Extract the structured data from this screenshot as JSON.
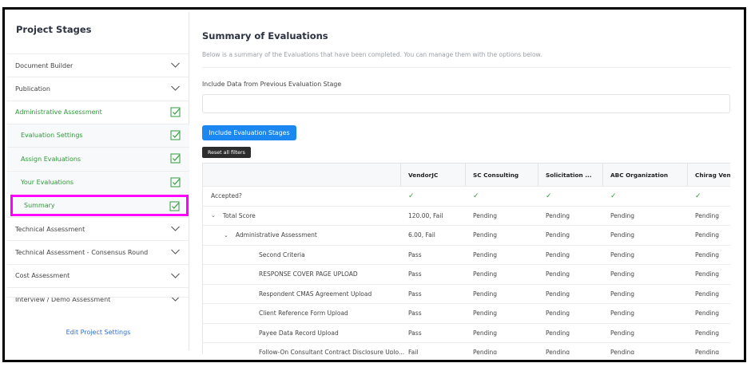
{
  "sidebar": {
    "title": "Project Stages",
    "items": [
      {
        "label": "Document Builder",
        "state": "collapsed",
        "sub": false,
        "green": false
      },
      {
        "label": "Publication",
        "state": "collapsed",
        "sub": false,
        "green": false
      },
      {
        "label": "Administrative Assessment",
        "state": "checked",
        "sub": false,
        "green": true
      },
      {
        "label": "Evaluation Settings",
        "state": "checked",
        "sub": true,
        "green": true
      },
      {
        "label": "Assign Evaluations",
        "state": "checked",
        "sub": true,
        "green": true
      },
      {
        "label": "Your Evaluations",
        "state": "checked",
        "sub": true,
        "green": true
      },
      {
        "label": "Summary",
        "state": "checked",
        "sub": true,
        "green": true,
        "selected": true
      },
      {
        "label": "Technical Assessment",
        "state": "collapsed",
        "sub": false,
        "green": false
      },
      {
        "label": "Technical Assessment - Consensus Round",
        "state": "collapsed",
        "sub": false,
        "green": false
      },
      {
        "label": "Cost Assessment",
        "state": "collapsed",
        "sub": false,
        "green": false
      },
      {
        "label": "Interview / Demo Assessment",
        "state": "collapsed",
        "sub": false,
        "green": false
      }
    ],
    "edit_link": "Edit Project Settings"
  },
  "main": {
    "title": "Summary of Evaluations",
    "subtitle": "Below is a summary of the Evaluations that have been completed. You can manage them with the options below.",
    "field_label": "Include Data from Previous Evaluation Stage",
    "field_value": "",
    "include_button": "Include Evaluation Stages",
    "reset_button": "Reset all filters"
  },
  "table": {
    "columns": [
      "",
      "VendorJC",
      "SC Consulting",
      "Solicitation ...",
      "ABC Organization",
      "Chirag Vendo"
    ],
    "rows": [
      {
        "indent": 0,
        "caret": "",
        "label": "Accepted?",
        "cells": [
          "✓",
          "✓",
          "✓",
          "✓",
          "✓"
        ],
        "check": true
      },
      {
        "indent": 0,
        "caret": "⌄",
        "label": "Total Score",
        "cells": [
          "120.00, Fail",
          "Pending",
          "Pending",
          "Pending",
          "Pending"
        ]
      },
      {
        "indent": 1,
        "caret": "⌄",
        "label": "Administrative Assessment",
        "cells": [
          "6.00, Fail",
          "Pending",
          "Pending",
          "Pending",
          "Pending"
        ]
      },
      {
        "indent": 2,
        "caret": "",
        "label": "Second Criteria",
        "cells": [
          "Pass",
          "Pending",
          "Pending",
          "Pending",
          "Pending"
        ]
      },
      {
        "indent": 2,
        "caret": "",
        "label": "RESPONSE COVER PAGE UPLOAD",
        "cells": [
          "Pass",
          "Pending",
          "Pending",
          "Pending",
          "Pending"
        ]
      },
      {
        "indent": 2,
        "caret": "",
        "label": "Respondent CMAS Agreement Upload",
        "cells": [
          "Pass",
          "Pending",
          "Pending",
          "Pending",
          "Pending"
        ]
      },
      {
        "indent": 2,
        "caret": "",
        "label": "Client Reference Form Upload",
        "cells": [
          "Pass",
          "Pending",
          "Pending",
          "Pending",
          "Pending"
        ]
      },
      {
        "indent": 2,
        "caret": "",
        "label": "Payee Data Record Upload",
        "cells": [
          "Pass",
          "Pending",
          "Pending",
          "Pending",
          "Pending"
        ]
      },
      {
        "indent": 2,
        "caret": "",
        "label": "Follow-On Consultant Contract Disclosure Uplo...",
        "cells": [
          "Fail",
          "Pending",
          "Pending",
          "Pending",
          "Pending"
        ]
      }
    ]
  },
  "colors": {
    "accent": "#1a88f0",
    "green": "#2f9a3a",
    "highlight": "#ff00ff",
    "link": "#2f6fd6"
  }
}
